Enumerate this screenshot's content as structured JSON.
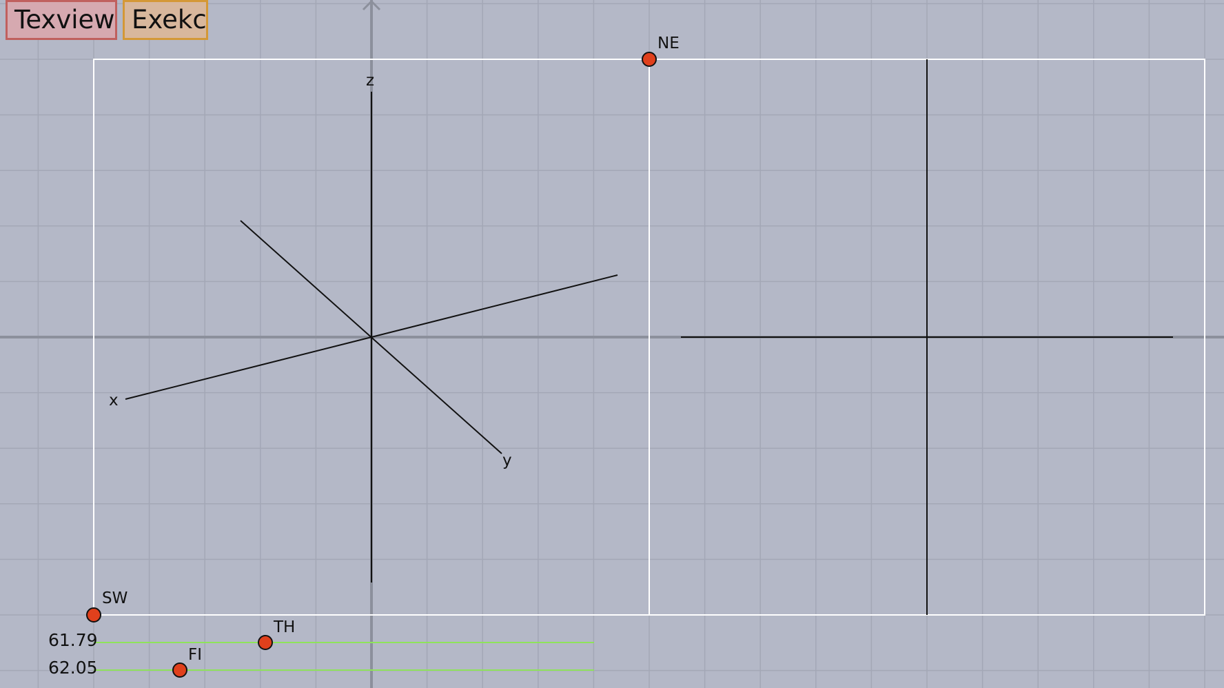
{
  "toolbar": {
    "texview_label": "Texview",
    "exekc_label": "Exekc"
  },
  "axes3d": {
    "x_label": "x",
    "y_label": "y",
    "z_label": "z"
  },
  "handles": {
    "ne": "NE",
    "sw": "SW",
    "th": "TH",
    "fi": "FI"
  },
  "sliders": {
    "th_value": "61.79",
    "fi_value": "62.05"
  },
  "colors": {
    "background": "#b4b8c7",
    "grid": "#a3a7b6",
    "handle_fill": "#e0401c",
    "slider_track": "#8ee35a",
    "frame": "#ffffff"
  }
}
